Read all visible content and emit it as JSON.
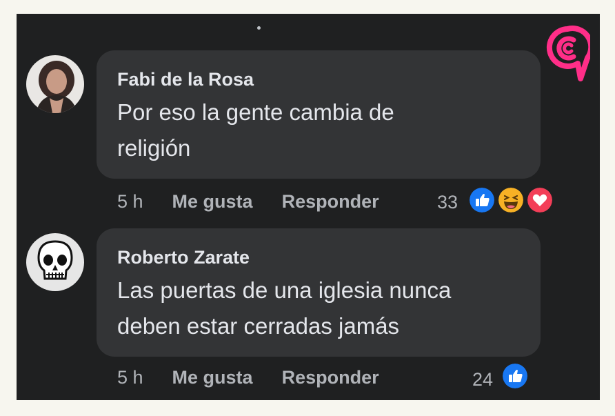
{
  "comments": [
    {
      "author": "Fabi de la Rosa",
      "text": "Por eso la gente cambia de\nreligión",
      "time": "5 h",
      "like_label": "Me gusta",
      "reply_label": "Responder",
      "reaction_count": "33",
      "reactions": [
        "like-icon",
        "haha-icon",
        "love-icon"
      ]
    },
    {
      "author": "Roberto Zarate",
      "text": "Las puertas de una iglesia nunca\ndeben estar cerradas jamás",
      "time": "5 h",
      "like_label": "Me gusta",
      "reply_label": "Responder",
      "reaction_count": "24",
      "reactions": [
        "like-icon"
      ]
    }
  ],
  "colors": {
    "background": "#1f2021",
    "bubble": "#333436",
    "text": "#e4e6eb",
    "muted": "#b0b3b8",
    "like_blue": "#1877f2",
    "love_red": "#f33e58",
    "haha_yellow": "#f7b125",
    "logo_pink": "#ff2e88"
  }
}
